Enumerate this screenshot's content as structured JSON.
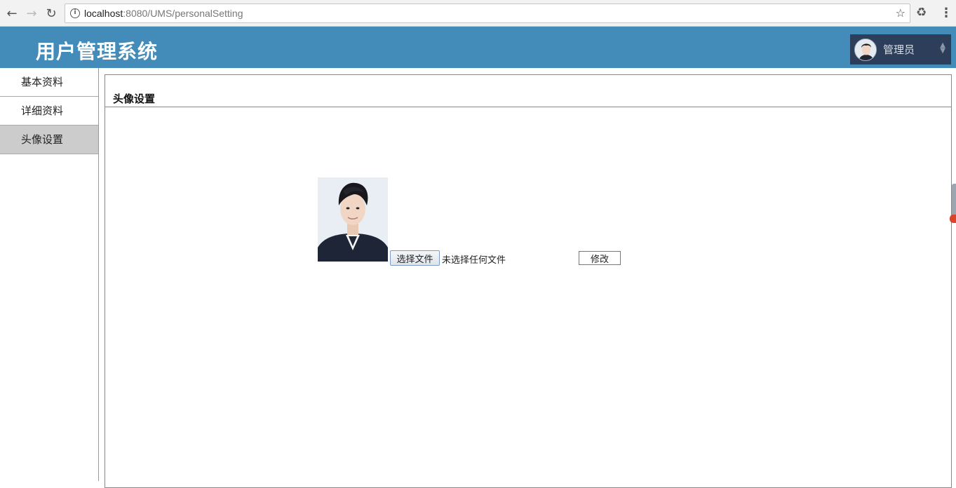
{
  "browser": {
    "url_host": "localhost",
    "url_path": ":8080/UMS/personalSetting",
    "back_icon": "arrow-left-icon",
    "forward_icon": "arrow-right-icon",
    "reload_icon": "reload-icon"
  },
  "header": {
    "title": "用户管理系统",
    "user_name": "管理员",
    "accent_color": "#438cba",
    "user_box_color": "#2c3e5a"
  },
  "sidebar": {
    "items": [
      {
        "label": "基本资料"
      },
      {
        "label": "详细资料"
      },
      {
        "label": "头像设置"
      }
    ],
    "active_index": 2
  },
  "main": {
    "panel_title": "头像设置",
    "file_button_label": "选择文件",
    "file_status": "未选择任何文件",
    "submit_label": "修改"
  }
}
